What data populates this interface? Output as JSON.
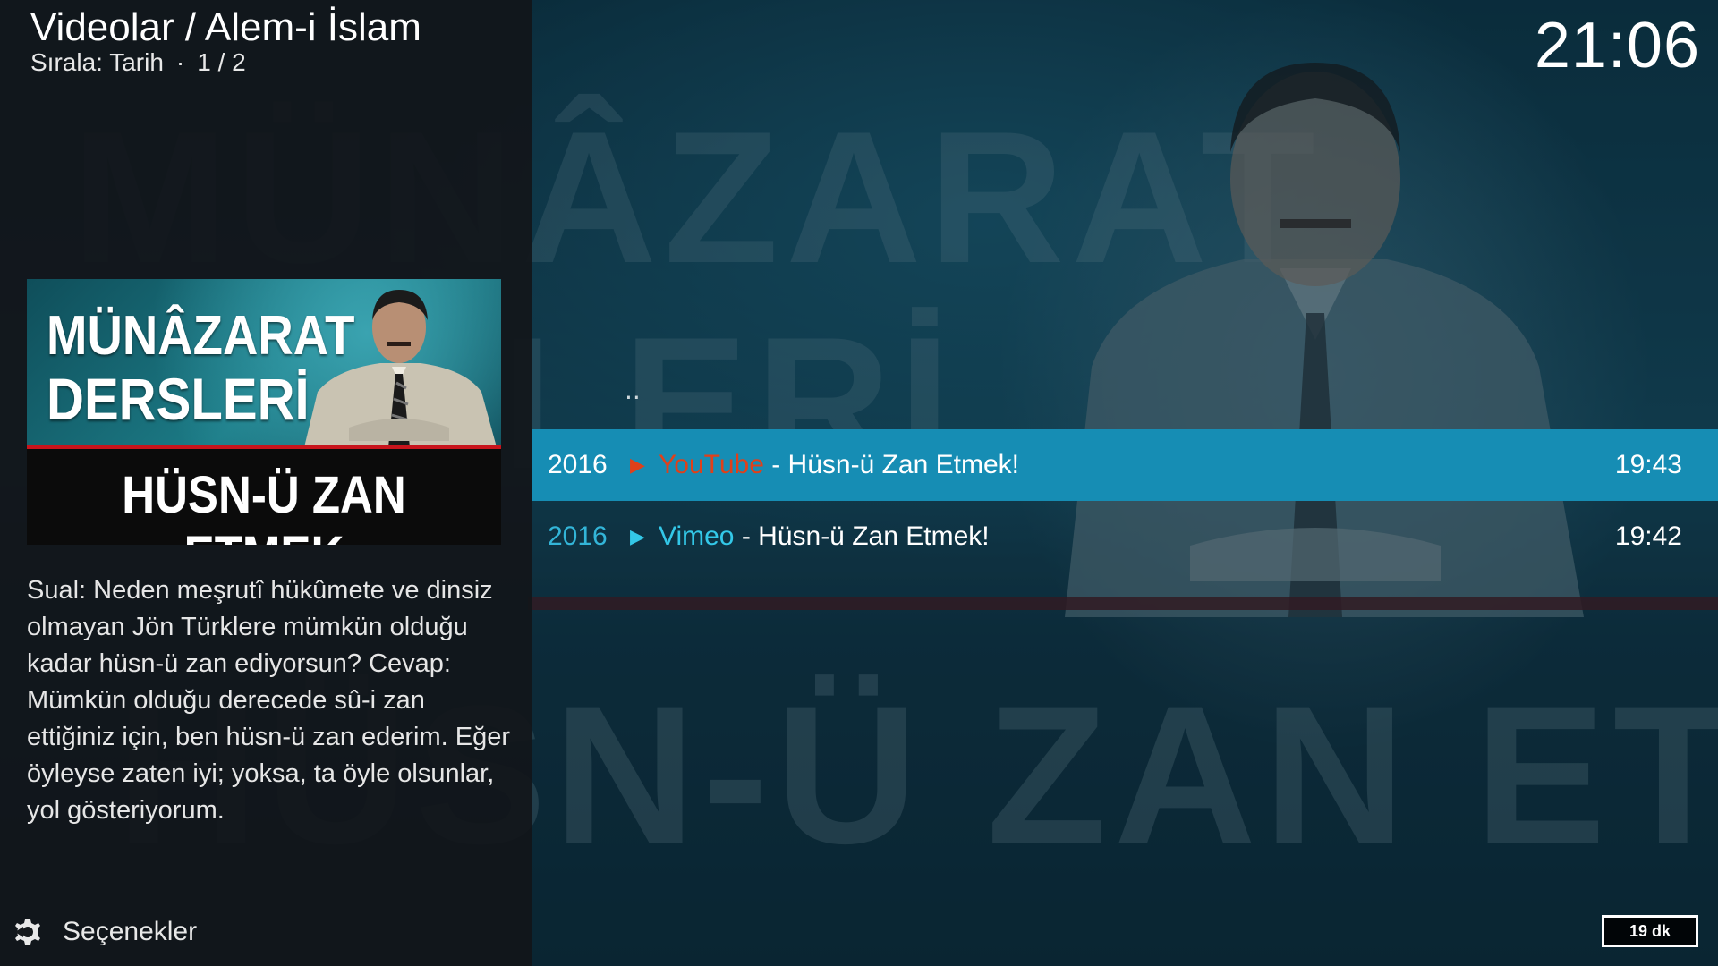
{
  "header": {
    "title": "Videolar / Alem-i İslam",
    "sort_label": "Sırala: Tarih",
    "separator": "·",
    "page": "1 / 2"
  },
  "clock": "21:06",
  "background": {
    "text_top": "MÜNÂZARAT",
    "text_middle": "LERİ",
    "text_bottom": "HÜSN-Ü ZAN ETMEK"
  },
  "thumbnail": {
    "line1": "MÜNÂZARAT",
    "line2": "DERSLERİ",
    "caption": "HÜSN-Ü ZAN ETMEK"
  },
  "plot": "Sual: Neden meşrutî hükûmete ve dinsiz olmayan Jön Türklere mümkün olduğu kadar hüsn-ü zan ediyorsun? Cevap: Mümkün olduğu derecede sû-i zan ettiğiniz için, ben hüsn-ü zan ederim. Eğer öyleyse zaten iyi; yoksa, ta öyle olsunlar, yol gösteriyorum.",
  "list": {
    "parent": "..",
    "items": [
      {
        "year": "2016",
        "play": "▶",
        "source": "YouTube",
        "title": " - Hüsn-ü Zan Etmek!",
        "time": "19:43",
        "focused": true
      },
      {
        "year": "2016",
        "play": "▶",
        "source": "Vimeo",
        "title": " - Hüsn-ü Zan Etmek!",
        "time": "19:42",
        "focused": false
      }
    ]
  },
  "footer": {
    "options_label": "Seçenekler",
    "options_icon": "gear-icon",
    "duration": "19 dk"
  },
  "colors": {
    "focus_bg": "#168db4",
    "youtube": "#e0401a",
    "vimeo": "#33c8e8",
    "accent_red": "#c8141c"
  }
}
